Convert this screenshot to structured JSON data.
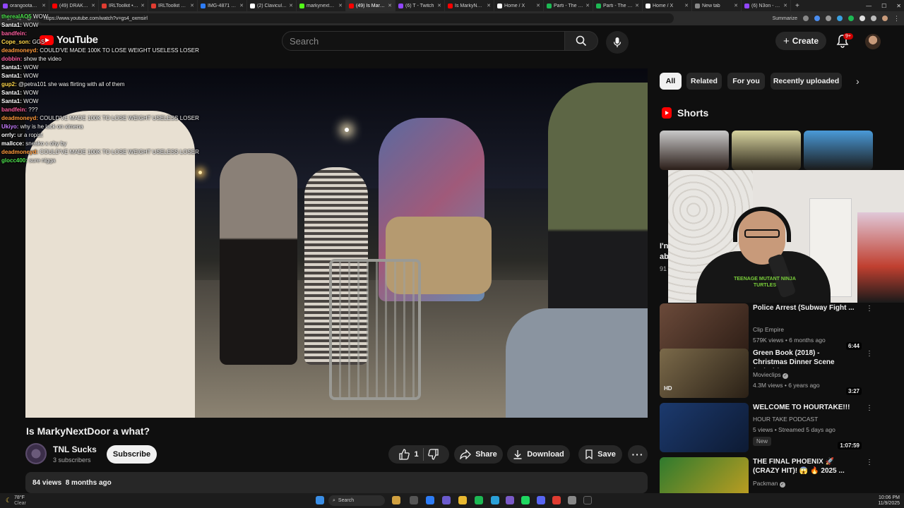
{
  "browser": {
    "tabs": [
      {
        "label": "orangootan: ...",
        "color": "#9146ff"
      },
      {
        "label": "(49) DRAKE & ...",
        "color": "#ff0000"
      },
      {
        "label": "IRLToolkit • Das...",
        "color": "#e03c31"
      },
      {
        "label": "IRLToolkit Remo...",
        "color": "#e03c31"
      },
      {
        "label": "IMG-4871 hosti...",
        "color": "#2d7cf6"
      },
      {
        "label": "(2) Clavicular o...",
        "color": "#ffffff"
      },
      {
        "label": "markynextdoor...",
        "color": "#53fc18"
      },
      {
        "label": "(49) Is MarkyN...",
        "color": "#ff0000",
        "active": true
      },
      {
        "label": "(6) T - Twitch",
        "color": "#9146ff"
      },
      {
        "label": "Is MarkyNextD...",
        "color": "#ff0000"
      },
      {
        "label": "Home / X",
        "color": "#ffffff"
      },
      {
        "label": "Parti - The Web...",
        "color": "#1db954"
      },
      {
        "label": "Parti - The Web...",
        "color": "#1db954"
      },
      {
        "label": "Home / X",
        "color": "#ffffff"
      },
      {
        "label": "New tab",
        "color": "#888888"
      },
      {
        "label": "(6) N3on - Twit...",
        "color": "#9146ff"
      }
    ],
    "new_tab": "+",
    "url": "https://www.youtube.com/watch?v=gs4_oxmsirl",
    "google_label": "Google",
    "summarize": "Summarize"
  },
  "chat": [
    {
      "user": "therealAO5",
      "text": "WOW",
      "color": "#4ee44e"
    },
    {
      "user": "Santa1:",
      "text": "WOW",
      "color": "#ffffff"
    },
    {
      "user": "bandfein:",
      "text": "",
      "color": "#ff5fa0"
    },
    {
      "user": "Cope_son:",
      "text": "GGS",
      "color": "#ffd84a"
    },
    {
      "user": "deadmoneyd:",
      "text": "COULD'VE MADE 100K TO LOSE WEIGHT USELESS LOSER",
      "color": "#ff9a3c"
    },
    {
      "user": "dobbin:",
      "text": "show the video",
      "color": "#ff5fa0"
    },
    {
      "user": "Santa1:",
      "text": "WOW",
      "color": "#ffffff"
    },
    {
      "user": "Santa1:",
      "text": "WOW",
      "color": "#ffffff"
    },
    {
      "user": "gup2:",
      "text": "@petra101 she was flirting with all of them",
      "color": "#ffd84a"
    },
    {
      "user": "Santa1:",
      "text": "WOW",
      "color": "#ffffff"
    },
    {
      "user": "Santa1:",
      "text": "WOW",
      "color": "#ffffff"
    },
    {
      "user": "bandfein:",
      "text": "???",
      "color": "#ff5fa0"
    },
    {
      "user": "deadmoneyd:",
      "text": "COULD'VE MADE 100K TO LOSE WEIGHT USELESS LOSER",
      "color": "#ff9a3c"
    },
    {
      "user": "Ukiyo:",
      "text": "why is he lack on ximena",
      "color": "#c77dff"
    },
    {
      "user": "orrly:",
      "text": "ur a ropist",
      "color": "#ffffff"
    },
    {
      "user": "mallcce:",
      "text": "sneako x ohy by",
      "color": "#ffffff"
    },
    {
      "user": "deadmoneyd:",
      "text": "COULD'VE MADE 100K TO LOSE WEIGHT USELESS LOSER",
      "color": "#ff9a3c"
    },
    {
      "user": "glocc400:",
      "text": "sure nigga",
      "color": "#4ee44e"
    }
  ],
  "yt": {
    "logo_text": "YouTube",
    "search_placeholder": "Search",
    "create_label": "Create",
    "notif_badge": "9+"
  },
  "video": {
    "title": "Is MarkyNextDoor a what?",
    "channel": "TNL Sucks",
    "subscribers": "3 subscribers",
    "subscribe_label": "Subscribe",
    "likes": "1",
    "share_label": "Share",
    "download_label": "Download",
    "save_label": "Save",
    "views": "84 views",
    "age": "8 months ago"
  },
  "sidebar": {
    "chips": [
      "All",
      "Related",
      "For you",
      "Recently uploaded"
    ],
    "shorts_label": "Shorts",
    "partial_title_a": "I'n",
    "partial_title_b": "ab",
    "partial_meta": "91",
    "recs": [
      {
        "title": "Police Arrest (Subway Fight ...",
        "channel": "Clip Empire",
        "meta": "579K views • 6 months ago",
        "duration": "6:44",
        "verified": false,
        "new": false,
        "bg": [
          "#6b4a3a",
          "#2e1e16"
        ]
      },
      {
        "title": "Green Book (2018) - Christmas Dinner Scene (10/10) | ...",
        "channel": "Movieclips",
        "meta": "4.3M views • 6 years ago",
        "duration": "3:27",
        "verified": true,
        "new": false,
        "badge": "HD",
        "bg": [
          "#7b6a4a",
          "#2a2016"
        ]
      },
      {
        "title": "WELCOME TO HOURTAKE!!!",
        "channel": "HOUR TAKE PODCAST",
        "meta": "5 views • Streamed 5 days ago",
        "duration": "1:07:59",
        "verified": false,
        "new": true,
        "new_label": "New",
        "bg": [
          "#1c3a6e",
          "#0d1a33"
        ]
      },
      {
        "title": "THE FINAL PHOENIX 🚀 (CRAZY HIT)! 😱 🔥 2025 ...",
        "channel": "Packman",
        "meta": "",
        "duration": "",
        "verified": true,
        "new": false,
        "bg": [
          "#2e7a2e",
          "#c8a020"
        ]
      }
    ]
  },
  "webcam": {
    "shirt_text": "TEENAGE MUTANT NINJA TURTLES"
  },
  "taskbar": {
    "weather_temp": "78°F",
    "weather_desc": "Clear",
    "search_label": "Search",
    "time": "10:06 PM",
    "date": "11/9/2025"
  },
  "colors": {
    "bg": "#0f0f0f",
    "accent_red": "#ff0000",
    "chip_bg": "#272727"
  }
}
